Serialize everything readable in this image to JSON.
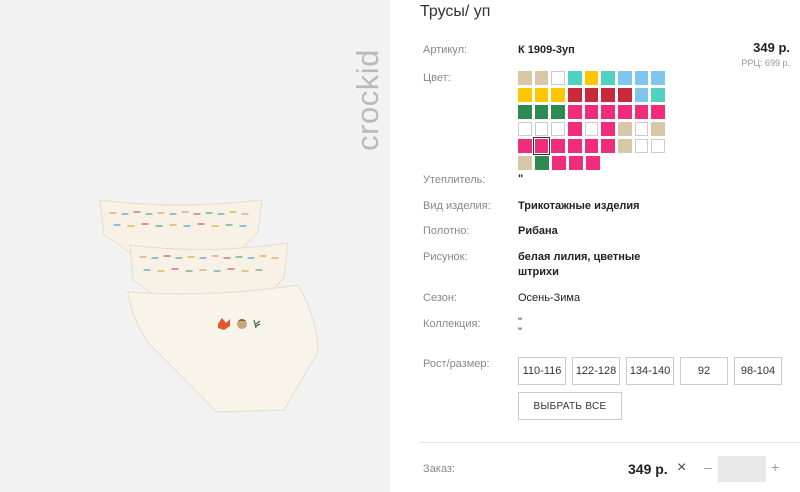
{
  "brand": {
    "logo_text": "crockid"
  },
  "product": {
    "title": "Трусы/ уп",
    "article_label": "Артикул:",
    "article_value": "К 1909-3уп",
    "price": "349 р.",
    "rrp": "РРЦ: 699 р.",
    "color_label": "Цвет:",
    "swatch_colors": [
      [
        "#d8c7a6",
        "#d8c7a6",
        "empty",
        "#4fd3c0",
        "#ffc600",
        "#4fd3c0",
        "#7fc5ee",
        "#7fc5ee",
        "#7fc5ee"
      ],
      [
        "#ffc600",
        "#ffc600",
        "#ffc600",
        "#c82a3c",
        "#c82a3c",
        "#c82a3c",
        "#c82a3c",
        "#7fc5ee",
        "#4fd3c0"
      ],
      [
        "#2e8b4f",
        "#2e8b4f",
        "#2e8b4f",
        "#ef2d7a",
        "#ef2d7a",
        "#ef2d7a",
        "#ef2d7a",
        "#ef2d7a",
        "#ef2d7a"
      ],
      [
        "empty",
        "empty",
        "empty",
        "#ef2d7a",
        "empty",
        "#ef2d7a",
        "#d8c7a6",
        "empty",
        "#d8c7a6"
      ],
      [
        "#ef2d7a",
        "#ef2d7a",
        "#ef2d7a",
        "#ef2d7a",
        "#ef2d7a",
        "#ef2d7a",
        "#d8c7a6",
        "empty",
        "empty"
      ],
      [
        "#d8c7a6",
        "#2e8b4f",
        "#ef2d7a",
        "#ef2d7a",
        "#ef2d7a"
      ]
    ],
    "selected_swatch": [
      4,
      1
    ],
    "insulation_label": "Утеплитель:",
    "insulation_value": "\"",
    "type_label": "Вид изделия:",
    "type_value": "Трикотажные изделия",
    "fabric_label": "Полотно:",
    "fabric_value": "Рибана",
    "pattern_label": "Рисунок:",
    "pattern_value": "белая лилия, цветные штрихи",
    "season_label": "Сезон:",
    "season_value": "Осень-Зима",
    "collection_label": "Коллекция:",
    "collection_value": "\" \"",
    "size_label": "Рост/размер:",
    "sizes": [
      "110-116",
      "122-128",
      "134-140",
      "92",
      "98-104"
    ],
    "select_all_label": "ВЫБРАТЬ ВСЕ"
  },
  "order": {
    "label": "Заказ:",
    "price": "349 р.",
    "remove_icon": "×",
    "minus": "–",
    "plus": "+",
    "quantity": ""
  }
}
